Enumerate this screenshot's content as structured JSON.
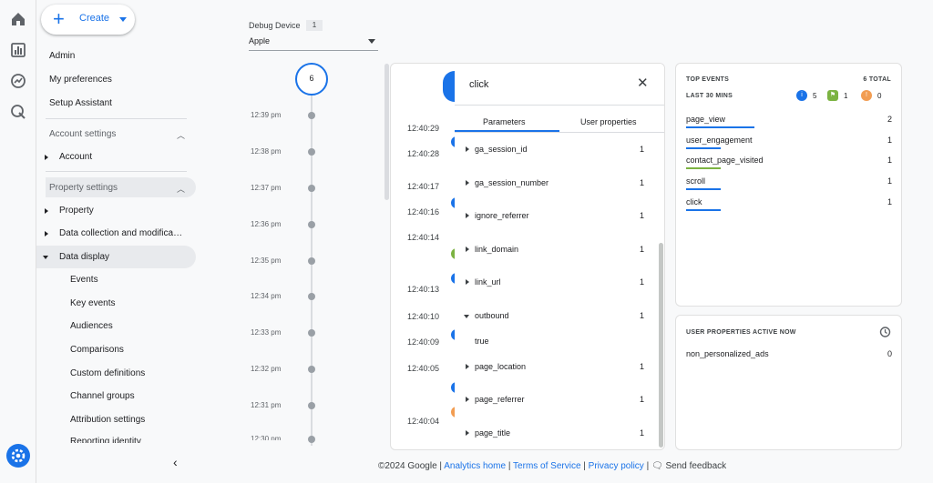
{
  "rail": {
    "icons": [
      "home-icon",
      "reports-icon",
      "explore-icon",
      "advertising-icon",
      "settings-icon"
    ]
  },
  "create": {
    "label": "Create"
  },
  "nav": {
    "admin": "Admin",
    "my_preferences": "My preferences",
    "setup_assistant": "Setup Assistant",
    "account_settings": "Account settings",
    "account": "Account",
    "property_settings": "Property settings",
    "property": "Property",
    "data_collection": "Data collection and modifica…",
    "data_display": "Data display",
    "sub_items": [
      "Events",
      "Key events",
      "Audiences",
      "Comparisons",
      "Custom definitions",
      "Channel groups",
      "Attribution settings",
      "Reporting identity"
    ]
  },
  "debug_device": {
    "label": "Debug Device",
    "count": "1",
    "selected": "Apple"
  },
  "minutes": {
    "total": "6",
    "times": [
      "12:39 pm",
      "12:38 pm",
      "12:37 pm",
      "12:36 pm",
      "12:35 pm",
      "12:34 pm",
      "12:33 pm",
      "12:32 pm",
      "12:31 pm",
      "12:30 pm"
    ]
  },
  "seconds": {
    "times": [
      "12:40:29",
      "12:40:28",
      "12:40:17",
      "12:40:16",
      "12:40:14",
      "12:40:13",
      "12:40:10",
      "12:40:09",
      "12:40:05",
      "12:40:04"
    ]
  },
  "detail": {
    "title": "click",
    "tabs": [
      "Parameters",
      "User properties"
    ],
    "params": [
      {
        "key": "ga_session_id",
        "value": "1"
      },
      {
        "key": "ga_session_number",
        "value": "1"
      },
      {
        "key": "ignore_referrer",
        "value": "1"
      },
      {
        "key": "link_domain",
        "value": "1"
      },
      {
        "key": "link_url",
        "value": "1"
      },
      {
        "key": "outbound",
        "value": "1"
      },
      {
        "key": "page_location",
        "value": "1"
      },
      {
        "key": "page_referrer",
        "value": "1"
      },
      {
        "key": "page_title",
        "value": "1"
      }
    ],
    "outbound_value": "true"
  },
  "top_events": {
    "title": "TOP EVENTS",
    "total": "6 TOTAL",
    "window": "LAST 30 MINS",
    "badges": [
      {
        "icon": "event-icon",
        "count": "5",
        "color": "#1a73e8"
      },
      {
        "icon": "flag-icon",
        "count": "1",
        "color": "#7cb342"
      },
      {
        "icon": "error-icon",
        "count": "0",
        "color": "#f29d52"
      }
    ],
    "events": [
      {
        "name": "page_view",
        "count": "2",
        "color": "#1a73e8"
      },
      {
        "name": "user_engagement",
        "count": "1",
        "color": "#1a73e8"
      },
      {
        "name": "contact_page_visited",
        "count": "1",
        "color": "#7cb342"
      },
      {
        "name": "scroll",
        "count": "1",
        "color": "#1a73e8"
      },
      {
        "name": "click",
        "count": "1",
        "color": "#1a73e8"
      }
    ]
  },
  "user_props": {
    "title": "USER PROPERTIES ACTIVE NOW",
    "items": [
      {
        "name": "non_personalized_ads",
        "value": "0"
      }
    ]
  },
  "footer": {
    "copyright": "©2024 Google",
    "analytics_home": "Analytics home",
    "terms": "Terms of Service",
    "privacy": "Privacy policy",
    "feedback": "Send feedback"
  }
}
